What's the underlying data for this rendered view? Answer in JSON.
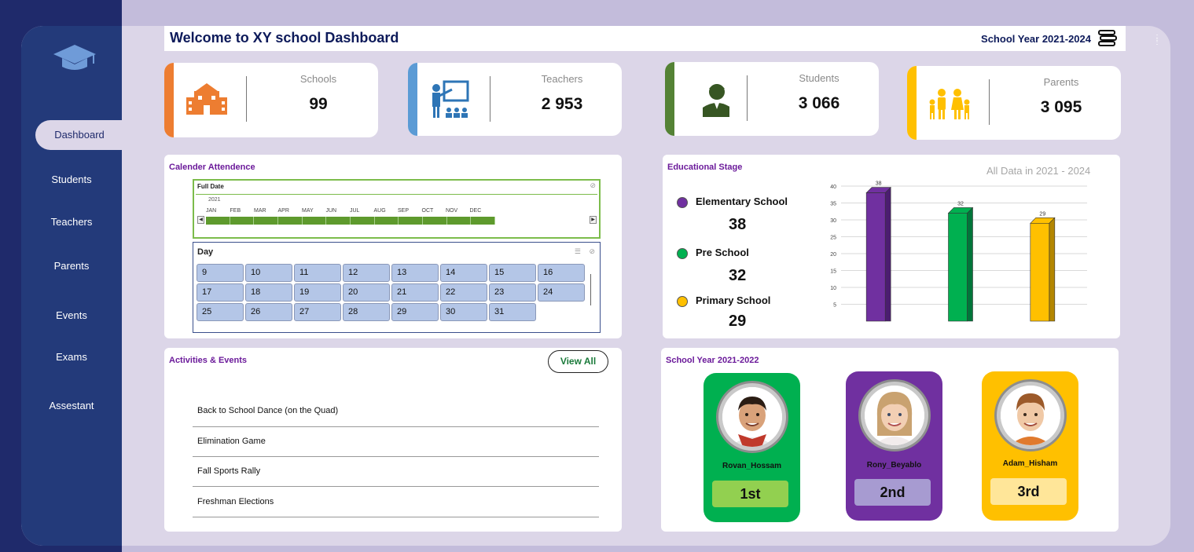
{
  "header": {
    "title": "Welcome to XY school Dashboard",
    "school_year": "School Year 2021-2024"
  },
  "sidebar": {
    "items": [
      {
        "label": "Dashboard",
        "active": true
      },
      {
        "label": "Students"
      },
      {
        "label": "Teachers"
      },
      {
        "label": "Parents"
      },
      {
        "label": "Events"
      },
      {
        "label": "Exams"
      },
      {
        "label": "Assestant"
      }
    ]
  },
  "kpis": [
    {
      "label": "Schools",
      "value": "99",
      "color": "#ed7d31",
      "icon": "school-icon"
    },
    {
      "label": "Teachers",
      "value": "2 953",
      "color": "#5b9bd5",
      "icon": "teacher-icon"
    },
    {
      "label": "Students",
      "value": "3 066",
      "color": "#548235",
      "icon": "student-icon"
    },
    {
      "label": "Parents",
      "value": "3 095",
      "color": "#ffc000",
      "icon": "parents-icon"
    }
  ],
  "calendar": {
    "title": "Calender Attendence",
    "date_slicer": {
      "header": "Full Date",
      "year": "2021",
      "months": [
        "JAN",
        "FEB",
        "MAR",
        "APR",
        "MAY",
        "JUN",
        "JUL",
        "AUG",
        "SEP",
        "OCT",
        "NOV",
        "DEC"
      ]
    },
    "day_slicer": {
      "header": "Day",
      "days": [
        "9",
        "10",
        "11",
        "12",
        "13",
        "14",
        "15",
        "16",
        "17",
        "18",
        "19",
        "20",
        "21",
        "22",
        "23",
        "24",
        "25",
        "26",
        "27",
        "28",
        "29",
        "30",
        "31"
      ]
    }
  },
  "education": {
    "title": "Educational Stage",
    "subtitle": "All Data in 2021 - 2024",
    "legend": [
      {
        "label": "Elementary School",
        "value": "38",
        "color": "#7030a0"
      },
      {
        "label": "Pre School",
        "value": "32",
        "color": "#00b050"
      },
      {
        "label": "Primary School",
        "value": "29",
        "color": "#ffc000"
      }
    ]
  },
  "chart_data": {
    "type": "bar",
    "categories": [
      "Elementary School",
      "Pre School",
      "Primary School"
    ],
    "values": [
      38,
      32,
      29
    ],
    "colors": [
      "#7030a0",
      "#00b050",
      "#ffc000"
    ],
    "data_labels": [
      "38",
      "32",
      "29"
    ],
    "ylim": [
      0,
      40
    ],
    "yticks": [
      "40",
      "35",
      "30",
      "25",
      "20",
      "15",
      "10",
      "5"
    ],
    "grid": true,
    "title": "",
    "xlabel": "",
    "ylabel": ""
  },
  "events": {
    "title": "Activities & Events",
    "view_all": "View All",
    "items": [
      "Back to School Dance (on the Quad)",
      "Elimination Game",
      "Fall Sports Rally",
      "Freshman Elections"
    ]
  },
  "ranking": {
    "title": "School Year 2021-2022",
    "students": [
      {
        "name": "Rovan_Hossam",
        "rank": "1st",
        "card_color": "#00b050",
        "badge_color": "#92d050"
      },
      {
        "name": "Rony_Beyablo",
        "rank": "2nd",
        "card_color": "#7030a0",
        "badge_color": "#a79bd1"
      },
      {
        "name": "Adam_Hisham",
        "rank": "3rd",
        "card_color": "#ffc000",
        "badge_color": "#ffe699"
      }
    ]
  }
}
